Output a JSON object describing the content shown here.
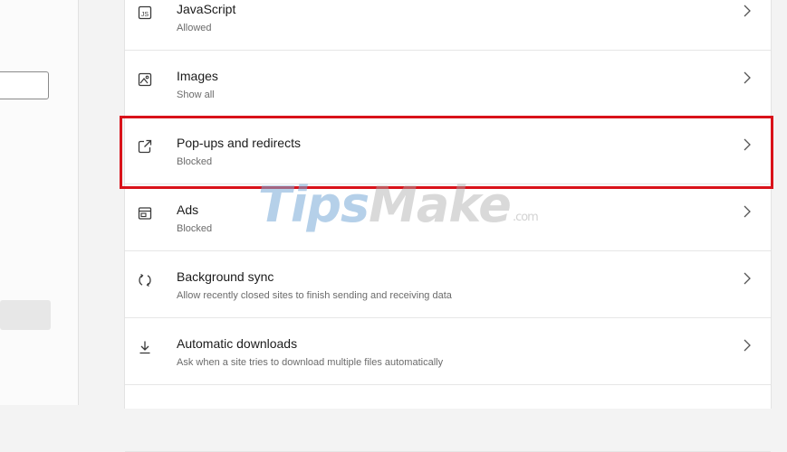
{
  "settings_list": {
    "items": [
      {
        "id": "javascript",
        "title": "JavaScript",
        "subtitle": "Allowed",
        "icon": "javascript-icon"
      },
      {
        "id": "images",
        "title": "Images",
        "subtitle": "Show all",
        "icon": "image-icon"
      },
      {
        "id": "popups",
        "title": "Pop-ups and redirects",
        "subtitle": "Blocked",
        "icon": "popup-icon"
      },
      {
        "id": "ads",
        "title": "Ads",
        "subtitle": "Blocked",
        "icon": "ads-icon"
      },
      {
        "id": "background-sync",
        "title": "Background sync",
        "subtitle": "Allow recently closed sites to finish sending and receiving data",
        "icon": "sync-icon"
      },
      {
        "id": "automatic-downloads",
        "title": "Automatic downloads",
        "subtitle": "Ask when a site tries to download multiple files automatically",
        "icon": "download-icon"
      }
    ]
  },
  "watermark": {
    "part1": "Tips",
    "part2": "Make",
    "part3": ".com"
  },
  "colors": {
    "highlight": "#d9121a",
    "watermark_blue": "#78aad7"
  }
}
